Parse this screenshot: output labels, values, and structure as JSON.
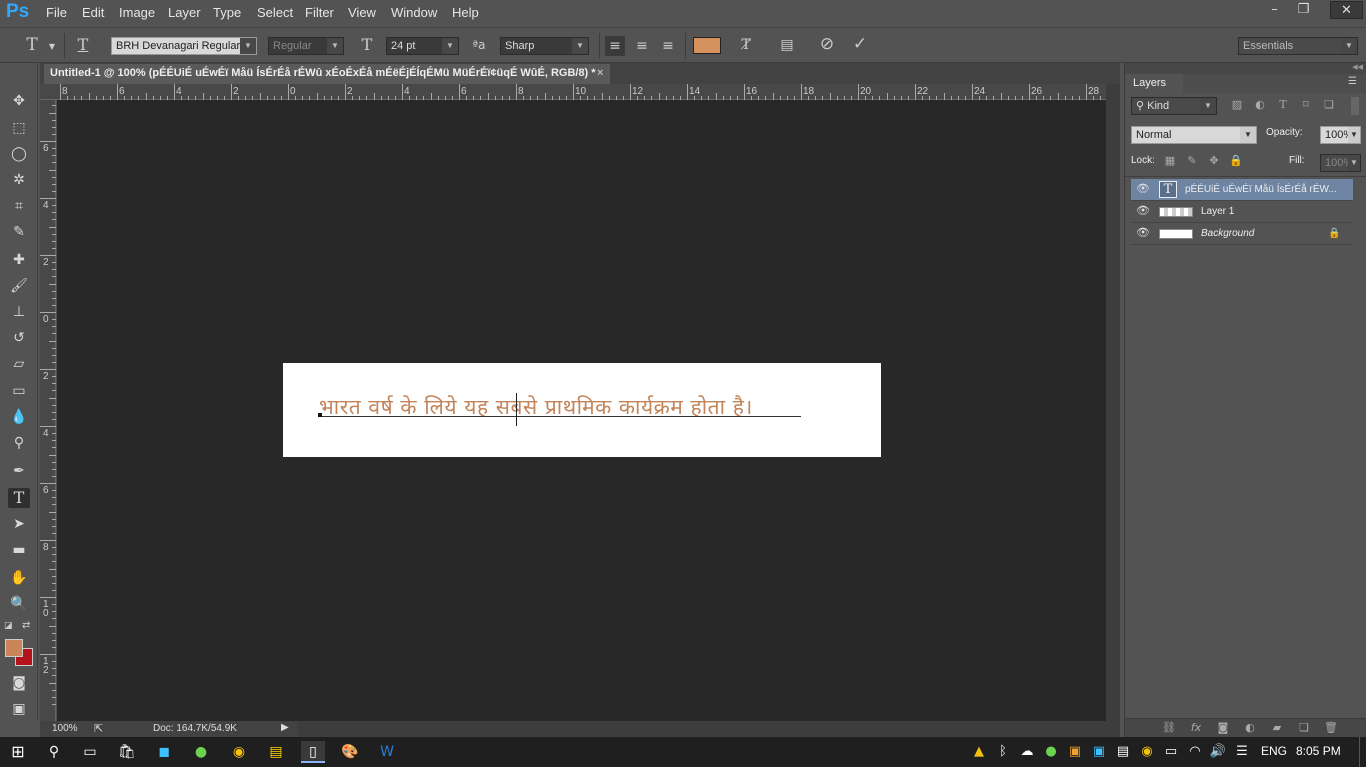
{
  "app": {
    "logo": "Ps"
  },
  "menu": [
    "File",
    "Edit",
    "Image",
    "Layer",
    "Type",
    "Select",
    "Filter",
    "View",
    "Window",
    "Help"
  ],
  "window_controls": {
    "minimize": "–",
    "restore": "❐",
    "close": "✕"
  },
  "options": {
    "font_family": "BRH Devanagari Regular",
    "font_style": "Regular",
    "font_size": "24 pt",
    "antialias_icon_label": "ªa",
    "antialias": "Sharp",
    "text_color": "#d4915e",
    "workspace": "Essentials"
  },
  "document": {
    "tab_title": "Untitled-1 @ 100% (pÉÉUiÉ uÉwÉï Måü ÍsÉrÉå rÉWû xÉoÉxÉå mÉëÉjÉÍqÉMü MüÉrÉï¢üqÉ WûÉ, RGB/8) *",
    "close": "×",
    "hindi_text": "भारत वर्ष के लिये यह सबसे प्राथमिक कार्यक्रम होता है।",
    "text_color": "#c3845a",
    "hruler": [
      "8",
      "6",
      "4",
      "2",
      "0",
      "2",
      "4",
      "6",
      "8",
      "10",
      "12",
      "14",
      "16",
      "18",
      "20",
      "22",
      "24",
      "26",
      "28"
    ],
    "vruler": [
      "8",
      "6",
      "4",
      "2",
      "0",
      "2",
      "4",
      "6",
      "8",
      "1\n0",
      "1\n2"
    ]
  },
  "status": {
    "zoom": "100%",
    "doc": "Doc: 164.7K/54.9K"
  },
  "colors": {
    "foreground": "#c98458",
    "background": "#b3141b",
    "selected_layer": "#6d84a3"
  },
  "layers_panel": {
    "tab": "Layers",
    "filter_kind": "Kind",
    "blend_mode": "Normal",
    "opacity_label": "Opacity:",
    "opacity": "100%",
    "lock_label": "Lock:",
    "fill_label": "Fill:",
    "fill": "100%",
    "layers": [
      {
        "name": "pÉÉUiÉ uÉwÉï Måü ÍsÉrÉå rÉW...",
        "type": "text",
        "selected": true
      },
      {
        "name": "Layer 1",
        "type": "pixel",
        "selected": false
      },
      {
        "name": "Background",
        "type": "background",
        "selected": false,
        "locked": true
      }
    ]
  },
  "taskbar": {
    "language": "ENG",
    "time": "8:05 PM"
  }
}
